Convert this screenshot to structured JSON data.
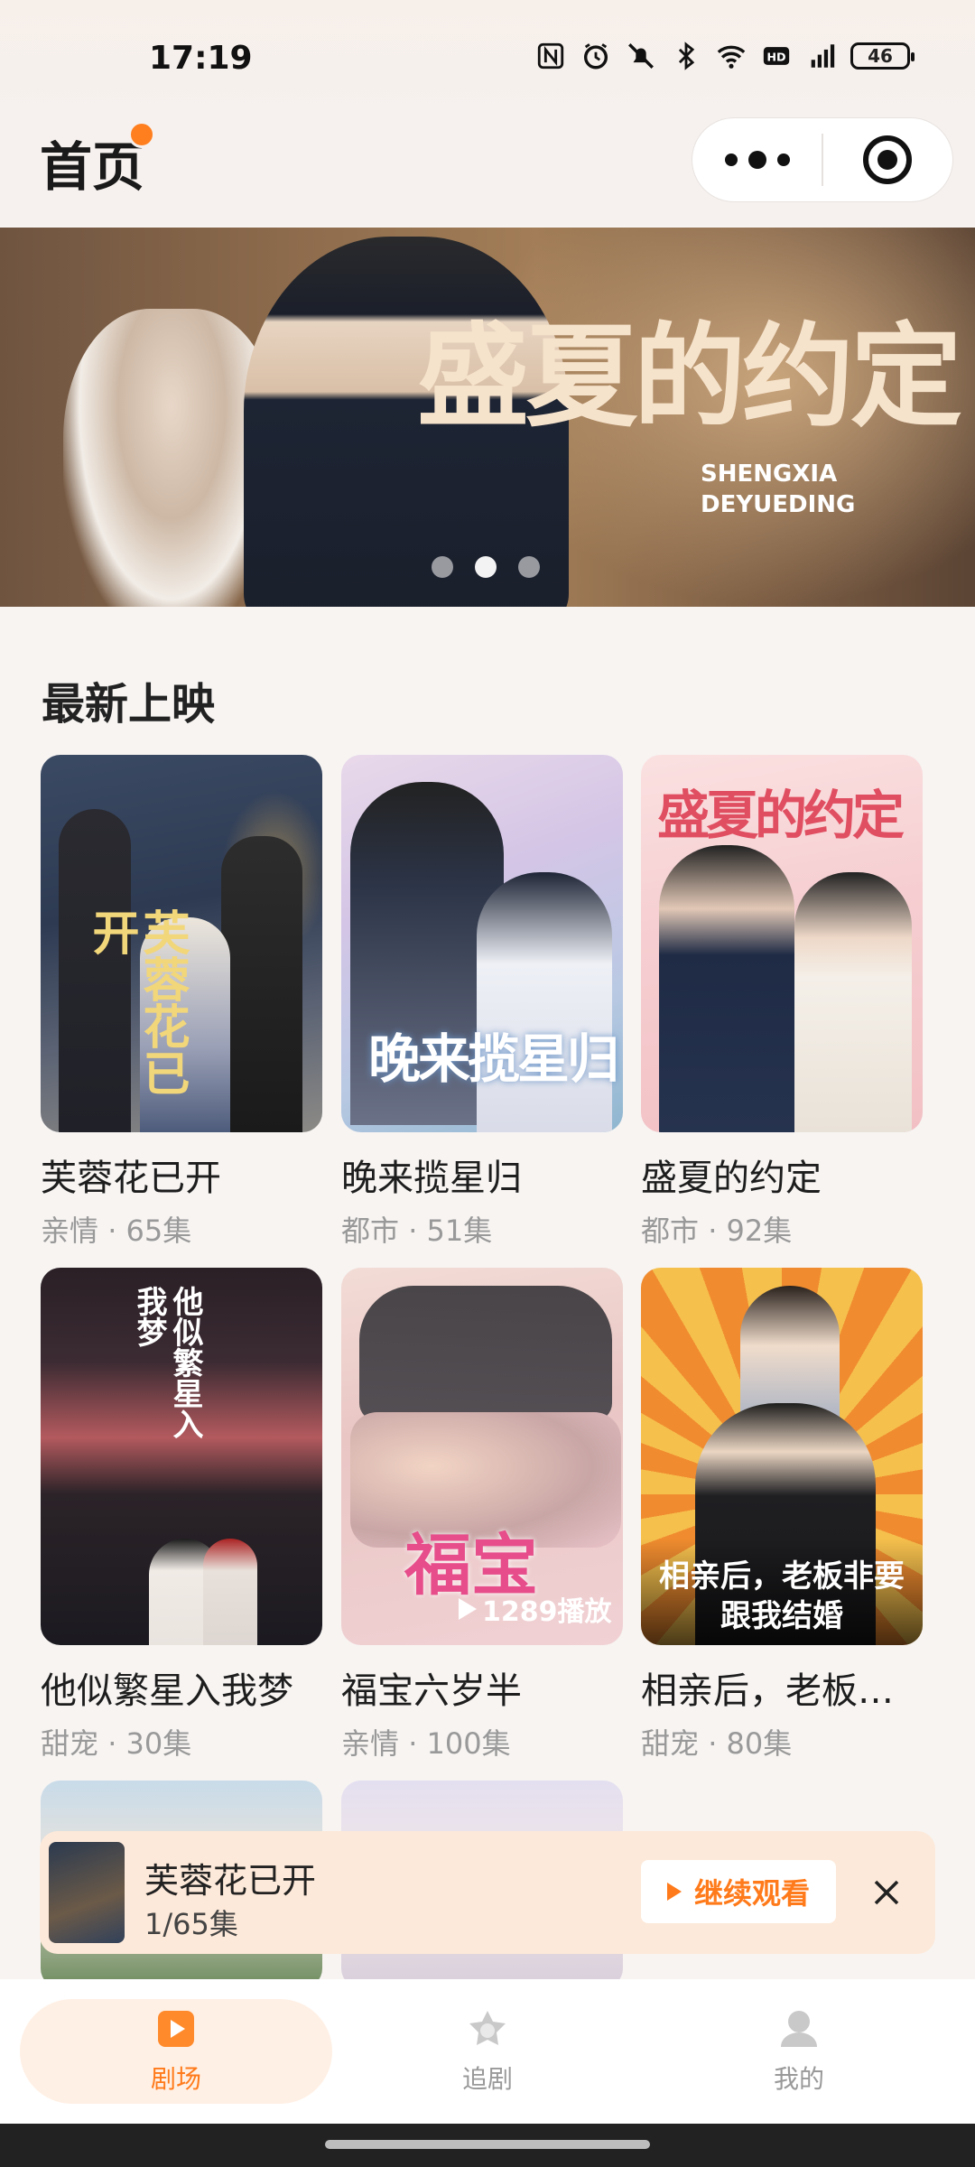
{
  "status": {
    "time": "17:19",
    "battery": "46"
  },
  "header": {
    "title": "首页"
  },
  "banner": {
    "title": "盛夏的约定",
    "subtitle_line1": "SHENGXIA",
    "subtitle_line2": "DEYUEDING",
    "dots_active_index": 1
  },
  "section": {
    "title": "最新上映"
  },
  "dramas": [
    {
      "name": "芙蓉花已开",
      "genre": "亲情",
      "episodes": "65集",
      "poster_text": "芙蓉花已开"
    },
    {
      "name": "晚来揽星归",
      "genre": "都市",
      "episodes": "51集",
      "poster_text": "晚来揽星归"
    },
    {
      "name": "盛夏的约定",
      "genre": "都市",
      "episodes": "92集",
      "poster_text": "盛夏的约定"
    },
    {
      "name": "他似繁星入我梦",
      "genre": "甜宠",
      "episodes": "30集",
      "poster_text": "他似繁星入我梦"
    },
    {
      "name": "福宝六岁半",
      "genre": "亲情",
      "episodes": "100集",
      "poster_text": "福宝",
      "play_count": "1289播放"
    },
    {
      "name": "相亲后，老板…",
      "genre": "甜宠",
      "episodes": "80集",
      "poster_text": "相亲后，老板非要跟我结婚"
    }
  ],
  "continue_watching": {
    "name": "芙蓉花已开",
    "progress": "1/65集",
    "button": "继续观看"
  },
  "tabs": [
    {
      "label": "剧场",
      "icon": "play-icon",
      "active": true
    },
    {
      "label": "追剧",
      "icon": "star-icon",
      "active": false
    },
    {
      "label": "我的",
      "icon": "user-icon",
      "active": false
    }
  ],
  "colors": {
    "accent": "#ff7a1a",
    "background": "#f7f4f2"
  }
}
